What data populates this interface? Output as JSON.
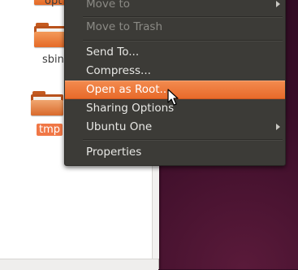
{
  "file_manager": {
    "folders": [
      {
        "label": "opt",
        "selected": false
      },
      {
        "label": "sbin",
        "selected": false
      },
      {
        "label": "tmp",
        "selected": true
      }
    ]
  },
  "context_menu": {
    "items": [
      {
        "label": "Move to",
        "enabled": false,
        "submenu": true
      },
      {
        "label": "Move to Trash",
        "enabled": false,
        "submenu": false
      },
      {
        "label": "Send To...",
        "enabled": true,
        "submenu": false
      },
      {
        "label": "Compress...",
        "enabled": true,
        "submenu": false
      },
      {
        "label": "Open as Root...",
        "enabled": true,
        "submenu": false,
        "highlighted": true
      },
      {
        "label": "Sharing Options",
        "enabled": true,
        "submenu": false
      },
      {
        "label": "Ubuntu One",
        "enabled": true,
        "submenu": true
      },
      {
        "label": "Properties",
        "enabled": true,
        "submenu": false
      }
    ]
  },
  "colors": {
    "highlight": "#e86a2a",
    "menu_bg": "#3c3b37",
    "folder_orange": "#e56a27",
    "desktop_bg": "#3a0d28"
  }
}
